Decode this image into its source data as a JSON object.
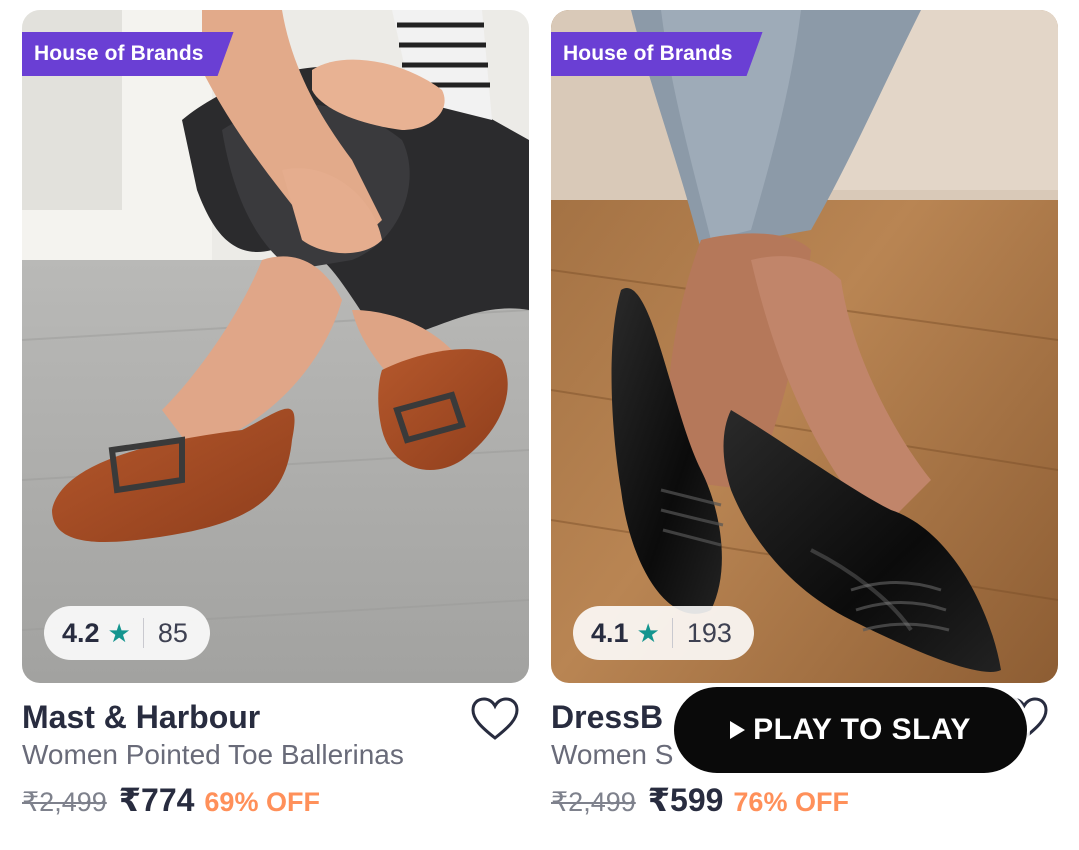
{
  "products": [
    {
      "badge": "House of Brands",
      "rating": "4.2",
      "rating_count": "85",
      "brand": "Mast & Harbour",
      "name": "Women Pointed Toe Ballerinas",
      "mrp": "₹2,499",
      "price": "₹774",
      "discount": "69% OFF",
      "image_desc": "woman-sitting-tan-loafers"
    },
    {
      "badge": "House of Brands",
      "rating": "4.1",
      "rating_count": "193",
      "brand": "DressB",
      "name": "Women S",
      "mrp": "₹2,499",
      "price": "₹599",
      "discount": "76% OFF",
      "image_desc": "black-patent-ballerinas"
    }
  ],
  "overlay": {
    "play_label": "PLAY TO SLAY"
  },
  "colors": {
    "badge_bg": "#6a3fd4",
    "star": "#14958f",
    "discount": "#ff905a",
    "text_primary": "#282c3f",
    "text_secondary": "#696b79"
  },
  "icons": {
    "wishlist": "heart-outline-icon",
    "rating": "star-icon",
    "play": "play-icon"
  }
}
